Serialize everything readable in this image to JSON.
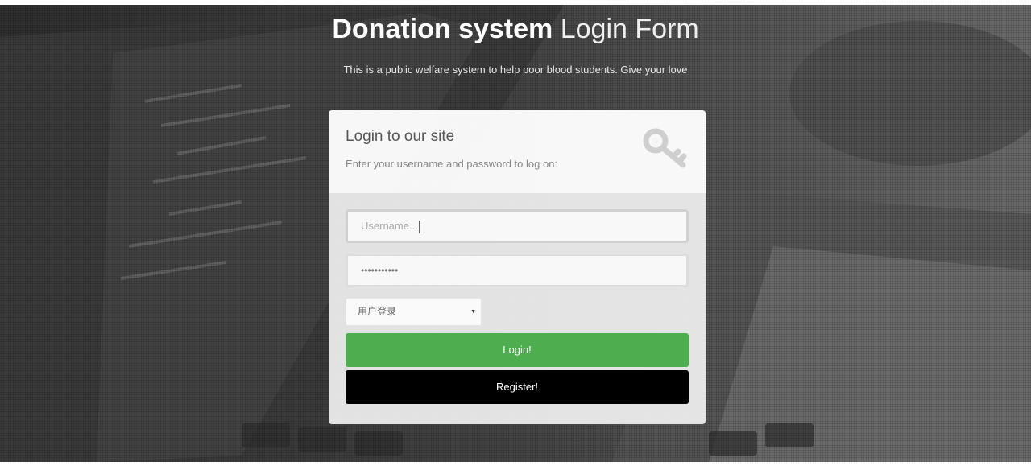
{
  "header": {
    "title_strong": "Donation system",
    "title_light": "Login Form",
    "subtitle": "This is a public welfare system to help poor blood students. Give your love"
  },
  "card": {
    "heading": "Login to our site",
    "description": "Enter your username and password to log on:",
    "icon": "key-icon"
  },
  "form": {
    "username_placeholder": "Username...",
    "password_masked": "•••••••••••",
    "role_selected": "用户登录",
    "login_label": "Login!",
    "register_label": "Register!"
  },
  "colors": {
    "login_button": "#4cae4c",
    "register_button": "#000000"
  }
}
